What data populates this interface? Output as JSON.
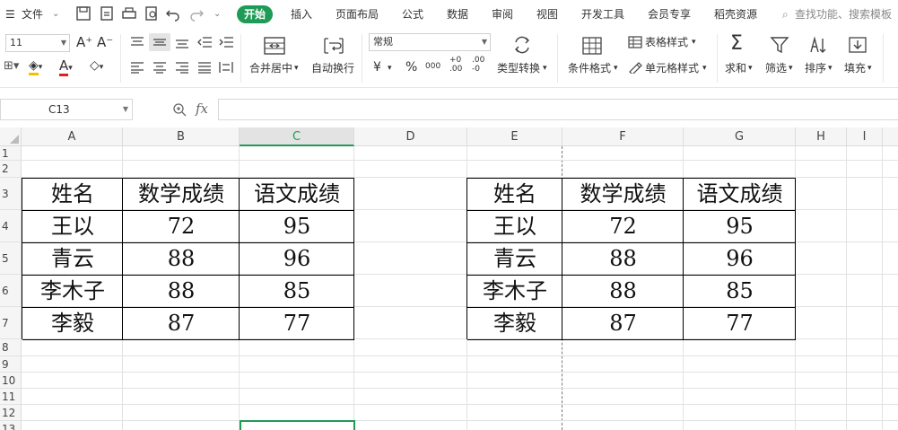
{
  "menubar": {
    "file_label": "文件",
    "tabs": [
      "开始",
      "插入",
      "页面布局",
      "公式",
      "数据",
      "审阅",
      "视图",
      "开发工具",
      "会员专享",
      "稻壳资源"
    ],
    "search_placeholder": "查找功能、搜索模板"
  },
  "ribbon": {
    "font_size": "11",
    "number_format": "常规",
    "merge_center": "合并居中",
    "wrap_text": "自动换行",
    "currency_symbol": "¥",
    "percent_symbol": "%",
    "thousands_symbol": "000",
    "type_convert": "类型转换",
    "cond_format": "条件格式",
    "table_style": "表格样式",
    "cell_style": "单元格样式",
    "sum": "求和",
    "filter": "筛选",
    "sort": "排序",
    "fill": "填充",
    "accent": "#1e9b56"
  },
  "formula_bar": {
    "name_box": "C13",
    "fx_label": "fx",
    "formula": ""
  },
  "grid": {
    "columns": [
      "A",
      "B",
      "C",
      "D",
      "E",
      "F",
      "G",
      "H",
      "I"
    ],
    "selected_column": "C",
    "rows": [
      "1",
      "2",
      "3",
      "4",
      "5",
      "6",
      "7",
      "8",
      "9",
      "10",
      "11",
      "12",
      "13"
    ],
    "selected_cell": "C13"
  },
  "table_left": {
    "headers": [
      "姓名",
      "数学成绩",
      "语文成绩"
    ],
    "rows": [
      [
        "王以",
        "72",
        "95"
      ],
      [
        "青云",
        "88",
        "96"
      ],
      [
        "李木子",
        "88",
        "85"
      ],
      [
        "李毅",
        "87",
        "77"
      ]
    ]
  },
  "table_right": {
    "headers": [
      "姓名",
      "数学成绩",
      "语文成绩"
    ],
    "rows": [
      [
        "王以",
        "72",
        "95"
      ],
      [
        "青云",
        "88",
        "96"
      ],
      [
        "李木子",
        "88",
        "85"
      ],
      [
        "李毅",
        "87",
        "77"
      ]
    ]
  }
}
